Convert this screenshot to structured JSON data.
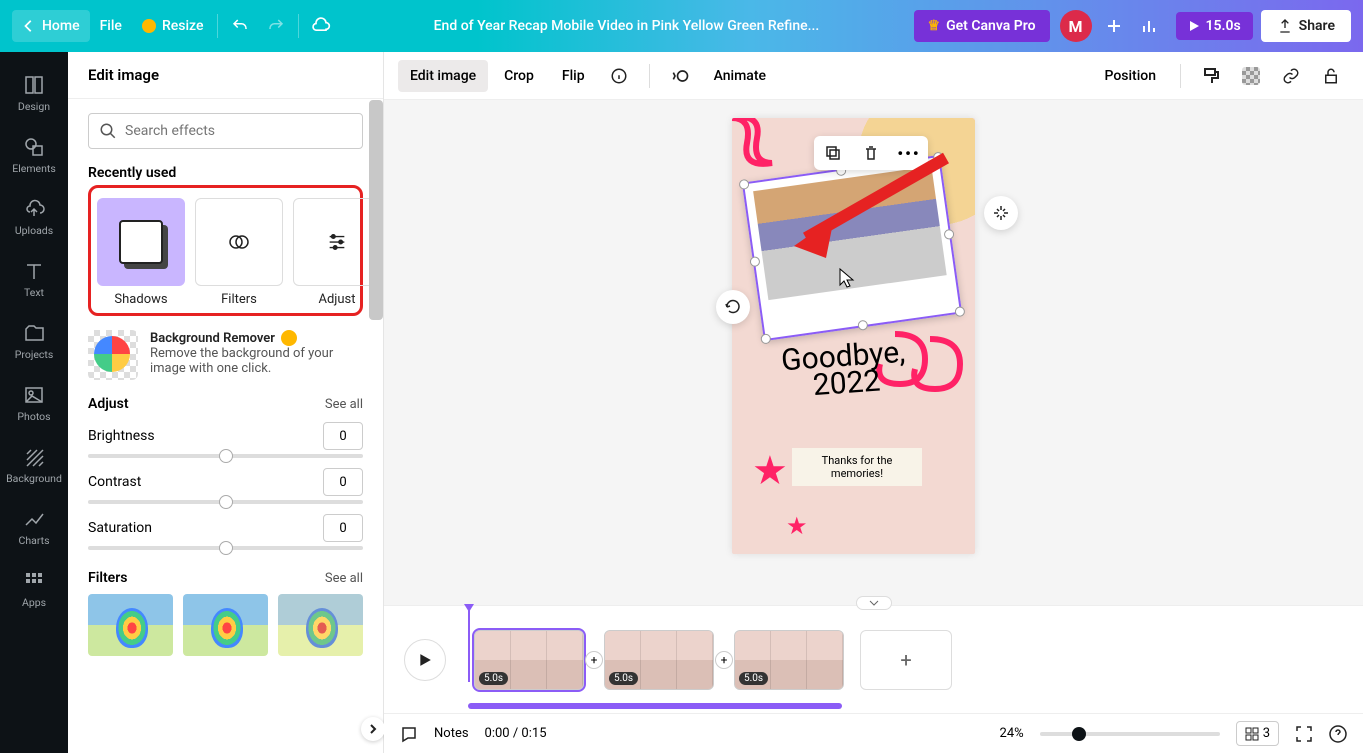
{
  "topbar": {
    "home": "Home",
    "file": "File",
    "resize": "Resize",
    "title": "End of Year Recap Mobile Video in Pink Yellow Green Refine...",
    "get_pro": "Get Canva Pro",
    "avatar_letter": "M",
    "duration": "15.0s",
    "share": "Share"
  },
  "rail": {
    "design": "Design",
    "elements": "Elements",
    "uploads": "Uploads",
    "text": "Text",
    "projects": "Projects",
    "photos": "Photos",
    "background": "Background",
    "charts": "Charts",
    "apps": "Apps"
  },
  "panel": {
    "title": "Edit image",
    "search_placeholder": "Search effects",
    "recent_title": "Recently used",
    "shadows": "Shadows",
    "filters": "Filters",
    "adjust": "Adjust",
    "bgr_title": "Background Remover",
    "bgr_desc": "Remove the background of your image with one click.",
    "adjust_title": "Adjust",
    "see_all": "See all",
    "brightness": "Brightness",
    "brightness_v": "0",
    "contrast": "Contrast",
    "contrast_v": "0",
    "saturation": "Saturation",
    "saturation_v": "0",
    "filters_title": "Filters"
  },
  "context": {
    "edit_image": "Edit image",
    "crop": "Crop",
    "flip": "Flip",
    "animate": "Animate",
    "position": "Position"
  },
  "canvas_text": {
    "line1": "Goodbye,",
    "line2": "2022",
    "memo1": "Thanks for the",
    "memo2": "memories!"
  },
  "timeline": {
    "clip1": "5.0s",
    "clip2": "5.0s",
    "clip3": "5.0s"
  },
  "footer": {
    "notes": "Notes",
    "time": "0:00 / 0:15",
    "zoom": "24%",
    "pages": "3"
  }
}
